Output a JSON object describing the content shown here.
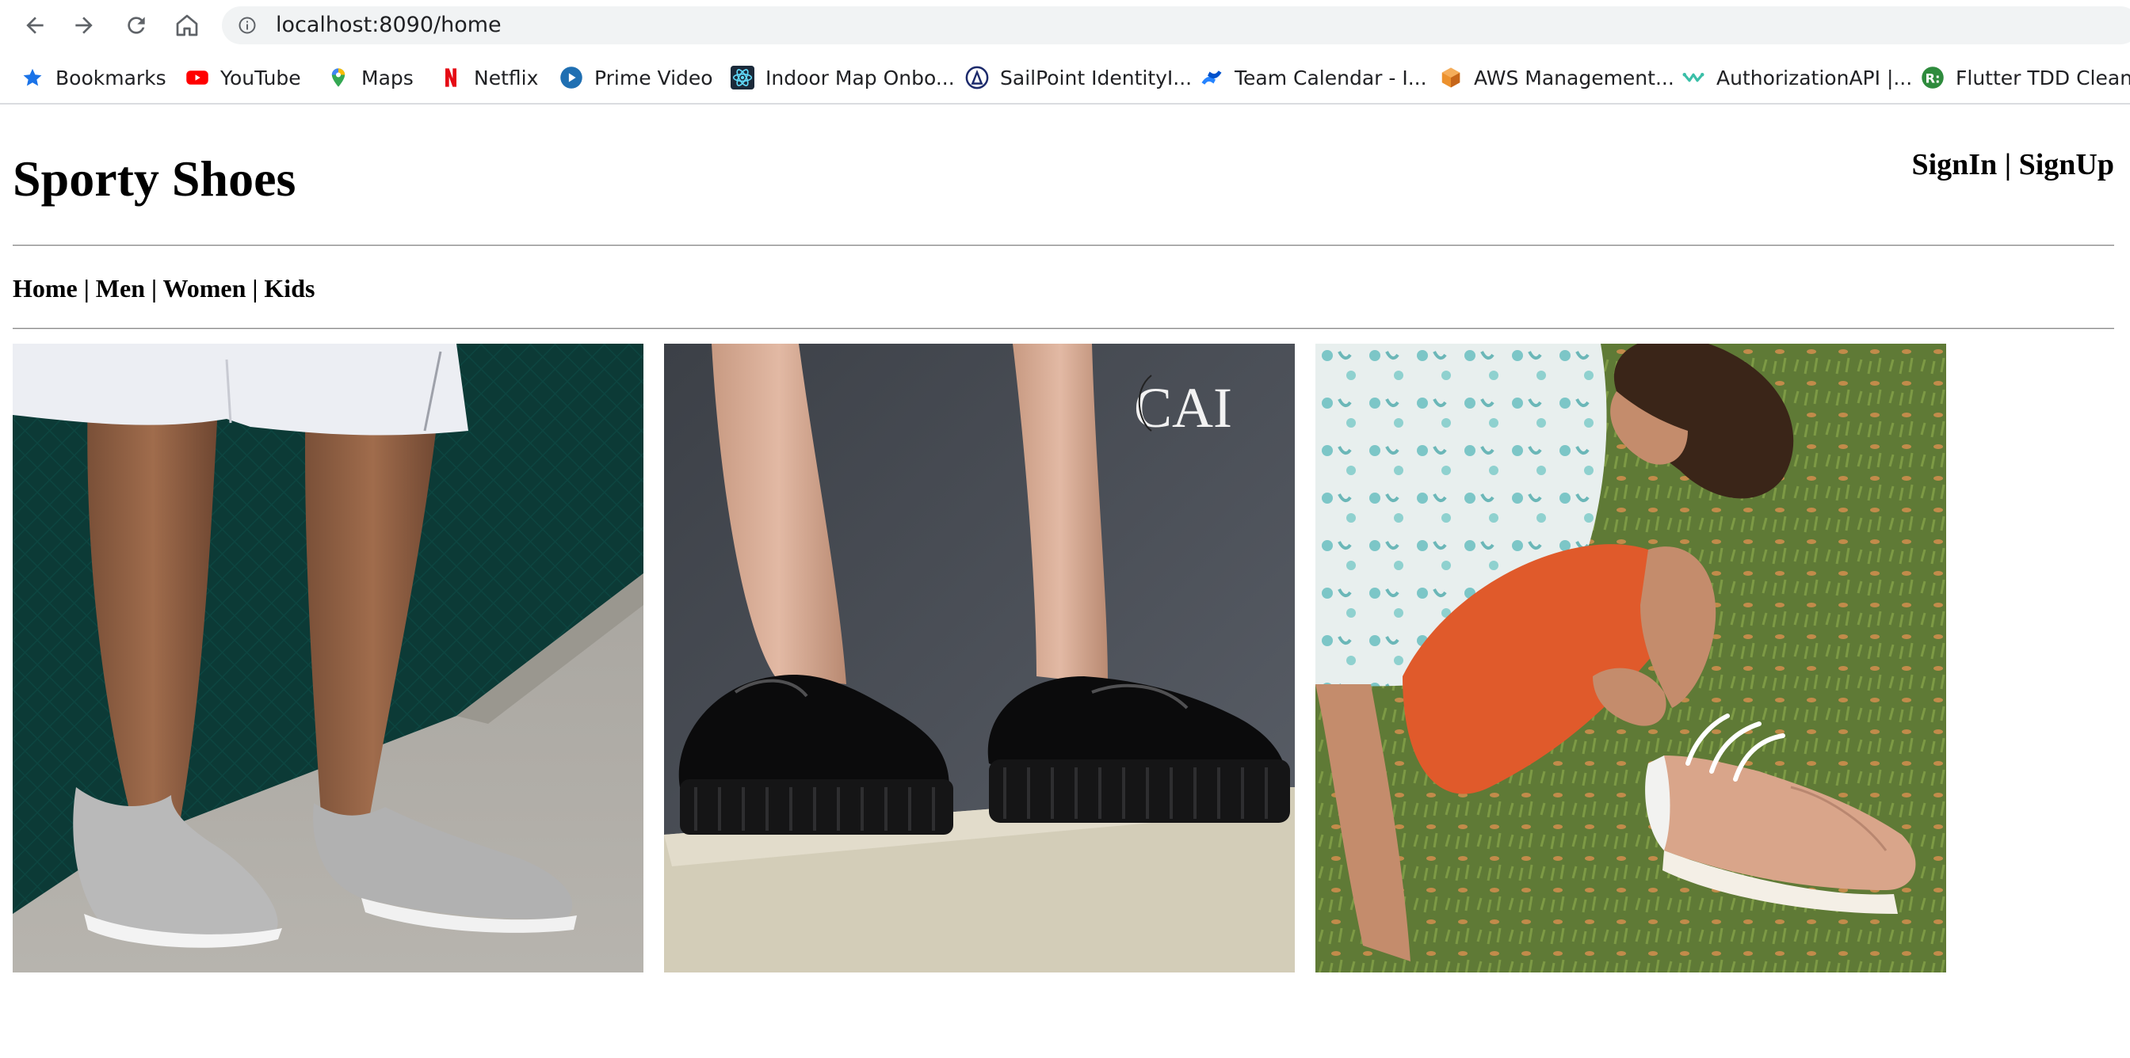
{
  "browser": {
    "url": "localhost:8090/home",
    "bookmarks": [
      {
        "label": "Bookmarks",
        "icon": "star-icon",
        "color": "#1a73e8"
      },
      {
        "label": "YouTube",
        "icon": "youtube-icon",
        "color": "#ff0000"
      },
      {
        "label": "Maps",
        "icon": "maps-pin-icon",
        "color": "#34a853"
      },
      {
        "label": "Netflix",
        "icon": "netflix-icon",
        "color": "#e50914"
      },
      {
        "label": "Prime Video",
        "icon": "prime-video-icon",
        "color": "#1f6fb2"
      },
      {
        "label": "Indoor Map Onbo...",
        "icon": "react-atom-icon",
        "color": "#1b2a3a"
      },
      {
        "label": "SailPoint IdentityI...",
        "icon": "sailpoint-icon",
        "color": "#1c2a6b"
      },
      {
        "label": "Team Calendar - I...",
        "icon": "confluence-icon",
        "color": "#2684ff"
      },
      {
        "label": "AWS Management...",
        "icon": "aws-cube-icon",
        "color": "#ec912d"
      },
      {
        "label": "AuthorizationAPI |...",
        "icon": "api-swirl-icon",
        "color": "#3bbfa8"
      },
      {
        "label": "Flutter TDD Clean...",
        "icon": "r-circle-icon",
        "color": "#2e8b3d"
      }
    ]
  },
  "site": {
    "title": "Sporty Shoes",
    "auth": {
      "signin": "SignIn",
      "separator": " | ",
      "signup": "SignUp"
    },
    "menu": [
      {
        "label": "Home"
      },
      {
        "label": "Men"
      },
      {
        "label": "Women"
      },
      {
        "label": "Kids"
      }
    ],
    "menu_separator": " | "
  },
  "gallery": [
    {
      "name": "men-shoes-photo"
    },
    {
      "name": "women-shoes-photo",
      "watermark": "CAI"
    },
    {
      "name": "kids-shoes-photo"
    }
  ]
}
